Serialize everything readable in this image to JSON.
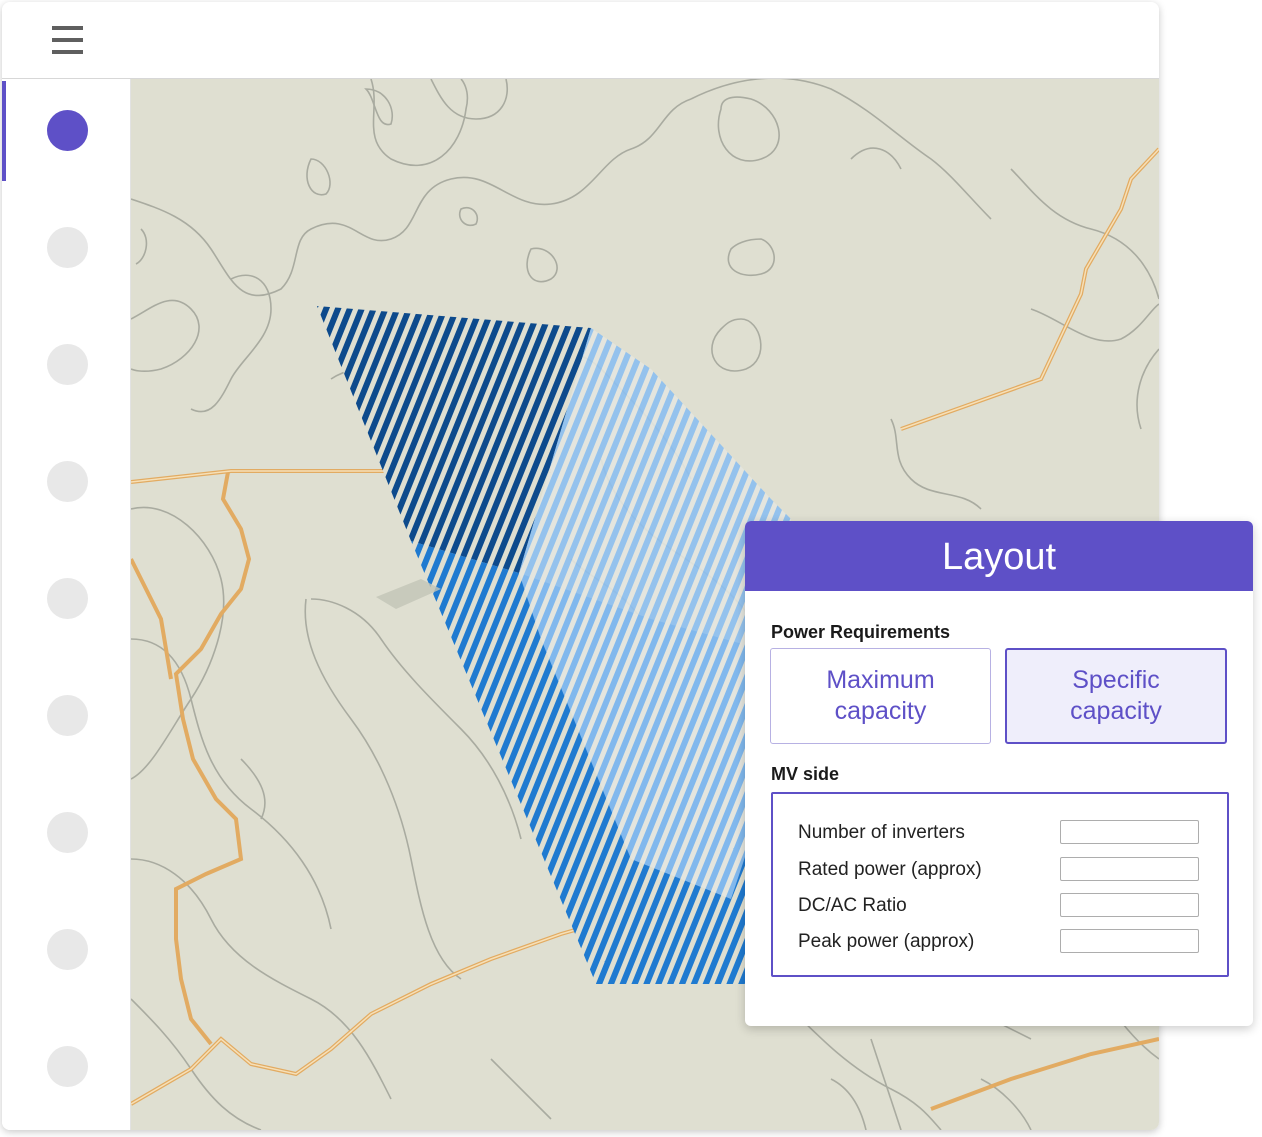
{
  "topbar": {
    "menu_icon": "hamburger-menu-icon"
  },
  "sidebar": {
    "steps": [
      {
        "state": "active"
      },
      {
        "state": "inactive"
      },
      {
        "state": "inactive"
      },
      {
        "state": "inactive"
      },
      {
        "state": "inactive"
      },
      {
        "state": "inactive"
      },
      {
        "state": "inactive"
      },
      {
        "state": "inactive"
      },
      {
        "state": "inactive"
      }
    ]
  },
  "colors": {
    "accent": "#5e50c7",
    "map_background": "#dfdfd1",
    "contour": "#a9aba0",
    "road": "#e2ab62",
    "area_dark": "#0d4a8c",
    "area_mid": "#1f7ad0",
    "area_light": "#8cbff0"
  },
  "panel": {
    "title": "Layout",
    "power_requirements": {
      "heading": "Power Requirements",
      "options": [
        {
          "label": "Maximum capacity",
          "line1": "Maximum",
          "line2": "capacity",
          "selected": false
        },
        {
          "label": "Specific capacity",
          "line1": "Specific",
          "line2": "capacity",
          "selected": true
        }
      ]
    },
    "mv_side": {
      "heading": "MV side",
      "fields": [
        {
          "label": "Number of inverters",
          "value": ""
        },
        {
          "label": "Rated power (approx)",
          "value": ""
        },
        {
          "label": "DC/AC Ratio",
          "value": ""
        },
        {
          "label": "Peak power (approx)",
          "value": ""
        }
      ]
    }
  }
}
